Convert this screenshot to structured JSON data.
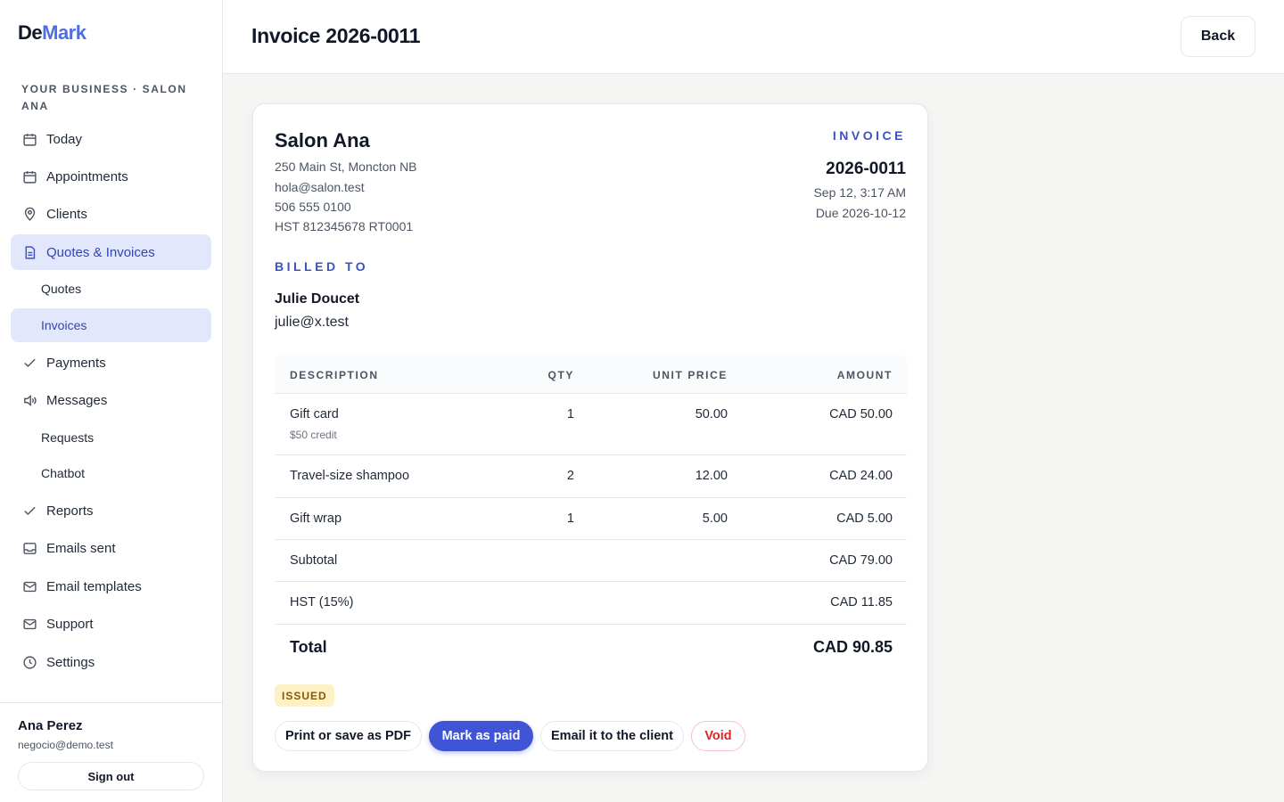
{
  "brand": {
    "part1": "De",
    "part2": "Mark"
  },
  "business_label": "YOUR BUSINESS · SALON ANA",
  "sidebar": {
    "items": [
      {
        "label": "Today",
        "icon": "calendar-icon"
      },
      {
        "label": "Appointments",
        "icon": "calendar-icon"
      },
      {
        "label": "Clients",
        "icon": "map-pin-icon"
      },
      {
        "label": "Quotes & Invoices",
        "icon": "document-icon",
        "active": true
      },
      {
        "label": "Payments",
        "icon": "check-icon"
      },
      {
        "label": "Messages",
        "icon": "speaker-icon"
      },
      {
        "label": "Reports",
        "icon": "check-icon"
      },
      {
        "label": "Emails sent",
        "icon": "inbox-icon"
      },
      {
        "label": "Email templates",
        "icon": "mail-icon"
      },
      {
        "label": "Support",
        "icon": "mail-icon"
      },
      {
        "label": "Settings",
        "icon": "clock-icon"
      }
    ],
    "sub_quotes": [
      {
        "label": "Quotes"
      },
      {
        "label": "Invoices",
        "active": true
      }
    ],
    "sub_messages": [
      {
        "label": "Requests"
      },
      {
        "label": "Chatbot"
      }
    ]
  },
  "user": {
    "name": "Ana Perez",
    "email": "negocio@demo.test",
    "signout_label": "Sign out"
  },
  "header": {
    "title": "Invoice 2026-0011",
    "back_label": "Back"
  },
  "invoice": {
    "business_name": "Salon Ana",
    "address": "250 Main St, Moncton NB",
    "email": "hola@salon.test",
    "phone": "506 555 0100",
    "tax_id": "HST 812345678 RT0001",
    "label": "INVOICE",
    "number": "2026-0011",
    "date": "Sep 12, 3:17 AM",
    "due": "Due 2026-10-12",
    "billed_to_label": "BILLED TO",
    "client_name": "Julie Doucet",
    "client_email": "julie@x.test",
    "columns": {
      "description": "DESCRIPTION",
      "qty": "QTY",
      "unit_price": "UNIT PRICE",
      "amount": "AMOUNT"
    },
    "lines": [
      {
        "description": "Gift card",
        "note": "$50 credit",
        "qty": "1",
        "unit_price": "50.00",
        "amount": "CAD 50.00"
      },
      {
        "description": "Travel-size shampoo",
        "qty": "2",
        "unit_price": "12.00",
        "amount": "CAD 24.00"
      },
      {
        "description": "Gift wrap",
        "qty": "1",
        "unit_price": "5.00",
        "amount": "CAD 5.00"
      }
    ],
    "subtotal_label": "Subtotal",
    "subtotal": "CAD 79.00",
    "tax_label": "HST (15%)",
    "tax": "CAD 11.85",
    "total_label": "Total",
    "total": "CAD 90.85",
    "status": "ISSUED"
  },
  "actions": {
    "print_label": "Print or save as PDF",
    "mark_paid_label": "Mark as paid",
    "email_label": "Email it to the client",
    "void_label": "Void"
  },
  "colors": {
    "accent": "#3f55d6",
    "active_bg": "#e3e7fb",
    "status_bg": "#fdf1c7",
    "danger": "#dc2626"
  }
}
